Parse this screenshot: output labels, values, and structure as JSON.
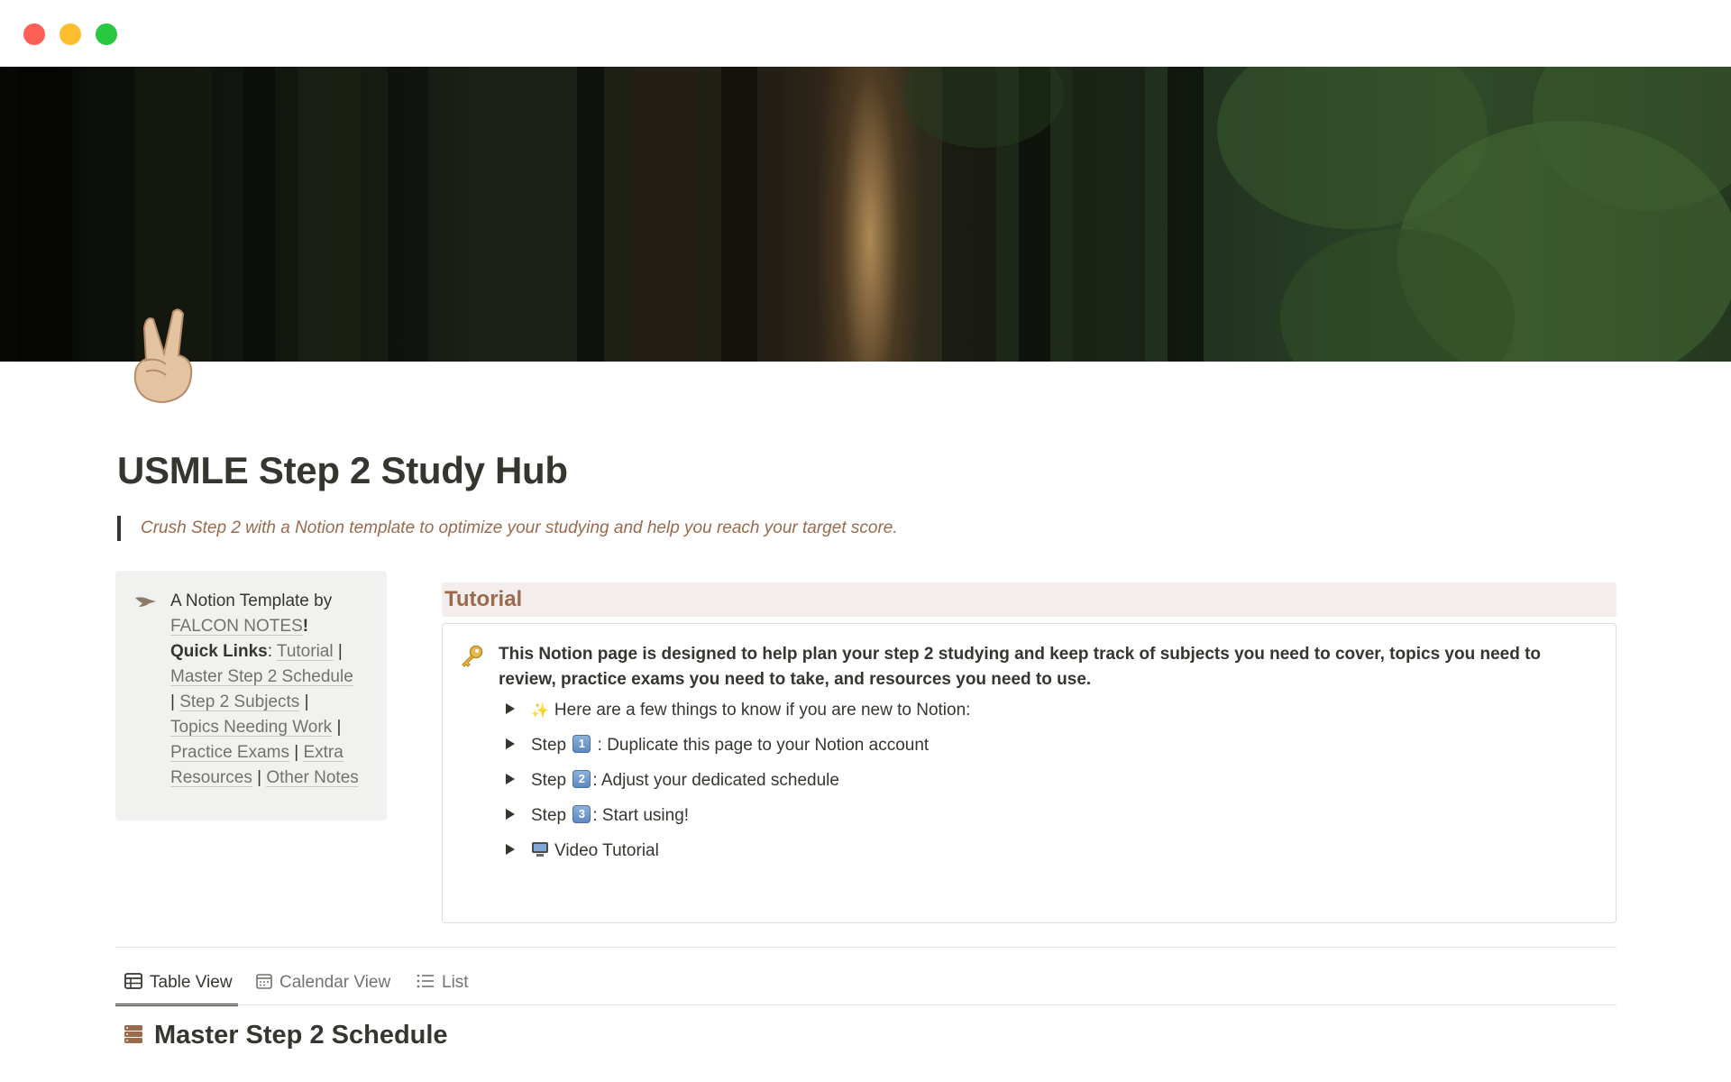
{
  "window": {
    "controls": [
      "close",
      "minimize",
      "maximize"
    ]
  },
  "cover": {
    "description_icon": "forest-cover-image"
  },
  "page": {
    "icon": "victory-hand-emoji",
    "title": "USMLE Step 2 Study Hub",
    "quote": "Crush Step 2 with a Notion template to optimize your studying and help you reach your target score."
  },
  "sidebar_callout": {
    "icon": "falcon-icon",
    "intro": "A Notion Template by",
    "brand": "FALCON NOTES",
    "brand_suffix": "!",
    "quick_links_label": "Quick Links",
    "quick_links_colon": ":",
    "separator": "|",
    "links": [
      "Tutorial",
      "Master Step 2 Schedule",
      "Step 2 Subjects",
      "Topics Needing Work",
      "Practice Exams",
      "Extra Resources",
      "Other Notes"
    ]
  },
  "tutorial": {
    "heading": "Tutorial",
    "icon": "key-icon",
    "description": "This Notion page is designed to help plan your step 2 studying and keep track of subjects you need to cover, topics you need to review, practice exams you need to take, and resources you need to use.",
    "toggles": [
      {
        "prefix_icon": "sparkles-icon",
        "text": "Here are a few things to know if you are new to Notion:"
      },
      {
        "before": "Step",
        "key": "1",
        "text": " : Duplicate this page to your Notion account"
      },
      {
        "before": "Step",
        "key": "2",
        "text": ": Adjust your dedicated schedule"
      },
      {
        "before": "Step",
        "key": "3",
        "text": ": Start using!"
      },
      {
        "prefix_icon": "computer-icon",
        "text": "Video Tutorial"
      }
    ]
  },
  "views": {
    "tabs": [
      {
        "label": "Table View",
        "icon": "table-icon",
        "active": true
      },
      {
        "label": "Calendar View",
        "icon": "calendar-icon",
        "active": false
      },
      {
        "label": "List",
        "icon": "list-icon",
        "active": false
      }
    ]
  },
  "database": {
    "icon": "database-icon",
    "title": "Master Step 2 Schedule"
  },
  "colors": {
    "accent_brown": "#9a6a4c",
    "heading_bg": "#f3eeec",
    "callout_bg": "#f1f1ef",
    "text": "#37352f"
  }
}
